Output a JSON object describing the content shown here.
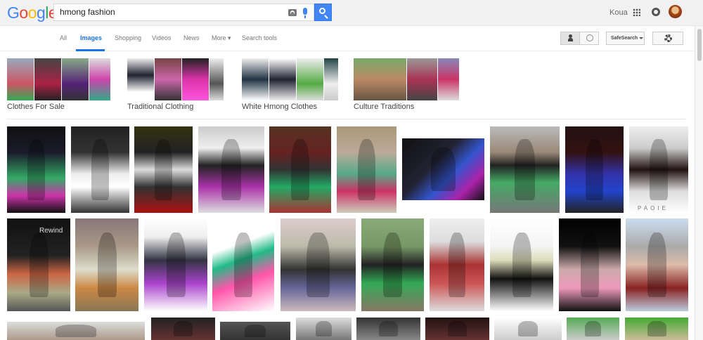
{
  "logo": {
    "text": "Google"
  },
  "search": {
    "query": "hmong fashion"
  },
  "user": {
    "name": "Koua"
  },
  "tabs": [
    {
      "label": "All"
    },
    {
      "label": "Images"
    },
    {
      "label": "Shopping"
    },
    {
      "label": "Videos"
    },
    {
      "label": "News"
    },
    {
      "label": "More ▾"
    },
    {
      "label": "Search tools"
    }
  ],
  "toolbar": {
    "safesearch_label": "SafeSearch"
  },
  "related": [
    {
      "label": "Clothes For Sale"
    },
    {
      "label": "Traditional Clothing"
    },
    {
      "label": "White Hmong Clothes"
    },
    {
      "label": "Culture Traditions"
    }
  ],
  "colors": {
    "accent": "#1a73e8",
    "search_button": "#4285f4",
    "header_bg": "#f1f1f1"
  },
  "icons": [
    "camera-icon",
    "mic-icon",
    "search-icon",
    "apps-icon",
    "notifications-icon",
    "person-icon",
    "globe-icon",
    "gear-icon",
    "caret-down-icon"
  ],
  "images": {
    "row1_count": 10,
    "row2_count": 10,
    "row3_visible_count": 10,
    "caption_overlays": [
      {
        "text": "Rewind"
      },
      {
        "text": "PAOIE"
      }
    ]
  }
}
